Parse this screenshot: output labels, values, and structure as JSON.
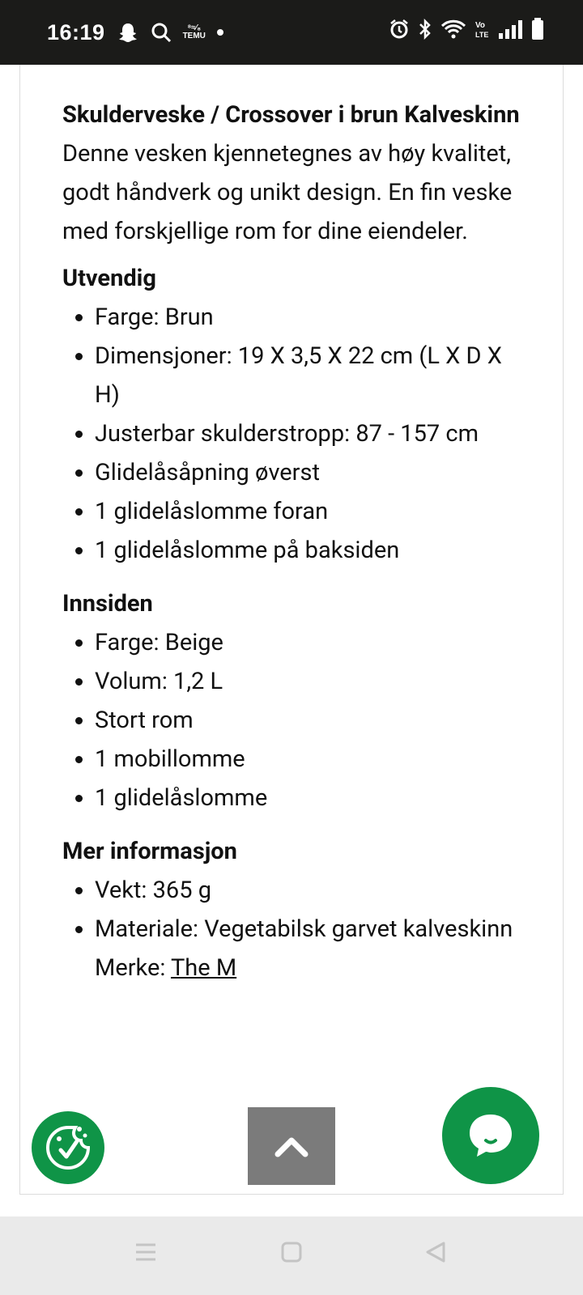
{
  "status_bar": {
    "time": "16:19",
    "temu_top": "⁸≈⁄₈",
    "temu_bottom": "TEMU"
  },
  "product": {
    "title": "Skulderveske / Crossover i brun Kalveskinn",
    "description": "Denne vesken kjennetegnes av høy kvalitet, godt håndverk og unikt design. En fin veske med forskjellige rom for dine eiendeler.",
    "sections": [
      {
        "heading": "Utvendig",
        "items": [
          "Farge: Brun",
          "Dimensjoner: 19 X 3,5 X 22 cm (L X D X H)",
          "Justerbar skulderstropp: 87 - 157 cm",
          "Glidelåsåpning øverst",
          "1 glidelåslomme foran",
          "1 glidelåslomme på baksiden"
        ]
      },
      {
        "heading": "Innsiden",
        "items": [
          "Farge: Beige",
          "Volum: 1,2 L",
          "Stort rom",
          "1 mobillomme",
          "1 glidelåslomme"
        ]
      },
      {
        "heading": "Mer informasjon",
        "items": [
          "Vekt: 365 g",
          "Materiale: Vegetabilsk garvet kalveskinn"
        ]
      }
    ],
    "brand_label": "Merke: ",
    "brand_link": "The M"
  },
  "colors": {
    "accent_green": "#0f9447",
    "scroll_gray": "#7b7b7b",
    "status_bar": "#1b1b19"
  },
  "icons": {
    "cookie": "cookie-consent-icon",
    "scroll": "chevron-up-icon",
    "chat": "chat-bubble-icon"
  }
}
